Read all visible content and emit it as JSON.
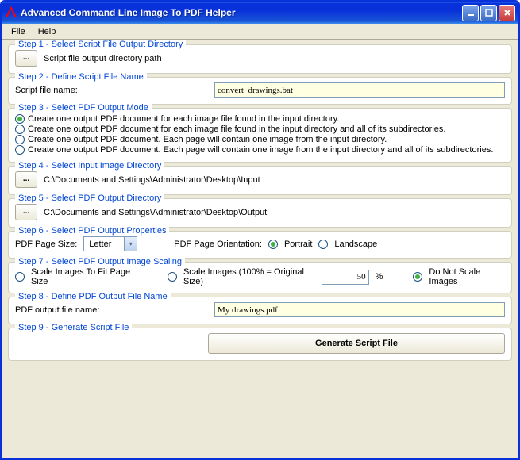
{
  "window": {
    "title": "Advanced Command Line Image To PDF Helper"
  },
  "menu": {
    "file": "File",
    "help": "Help"
  },
  "step1": {
    "title": "Step 1 - Select Script File Output Directory",
    "browse": "...",
    "path": "Script file output directory path"
  },
  "step2": {
    "title": "Step 2 - Define Script File Name",
    "label": "Script file name:",
    "value": "convert_drawings.bat"
  },
  "step3": {
    "title": "Step 3 - Select PDF Output Mode",
    "opt1": "Create one output PDF document for each image file found in the input directory.",
    "opt2": "Create one output PDF document for each image file found in the input directory and all of its subdirectories.",
    "opt3": "Create one output PDF document. Each page will contain one image from the input directory.",
    "opt4": "Create one output PDF document. Each page will contain one image from the input directory and all of its subdirectories."
  },
  "step4": {
    "title": "Step 4 - Select Input Image Directory",
    "browse": "...",
    "path": "C:\\Documents and Settings\\Administrator\\Desktop\\Input"
  },
  "step5": {
    "title": "Step 5 - Select PDF Output Directory",
    "browse": "...",
    "path": "C:\\Documents and Settings\\Administrator\\Desktop\\Output"
  },
  "step6": {
    "title": "Step 6 - Select PDF Output Properties",
    "page_size_label": "PDF Page Size:",
    "page_size_value": "Letter",
    "orientation_label": "PDF Page Orientation:",
    "portrait": "Portrait",
    "landscape": "Landscape"
  },
  "step7": {
    "title": "Step 7 - Select PDF Output Image Scaling",
    "fit": "Scale Images To Fit Page Size",
    "pct_label": "Scale Images (100% = Original Size)",
    "pct_value": "50",
    "pct_suffix": "%",
    "none": "Do Not Scale Images"
  },
  "step8": {
    "title": "Step 8 - Define PDF Output File Name",
    "label": "PDF output file name:",
    "value": "My drawings.pdf"
  },
  "step9": {
    "title": "Step 9 - Generate Script File",
    "button": "Generate Script File"
  }
}
